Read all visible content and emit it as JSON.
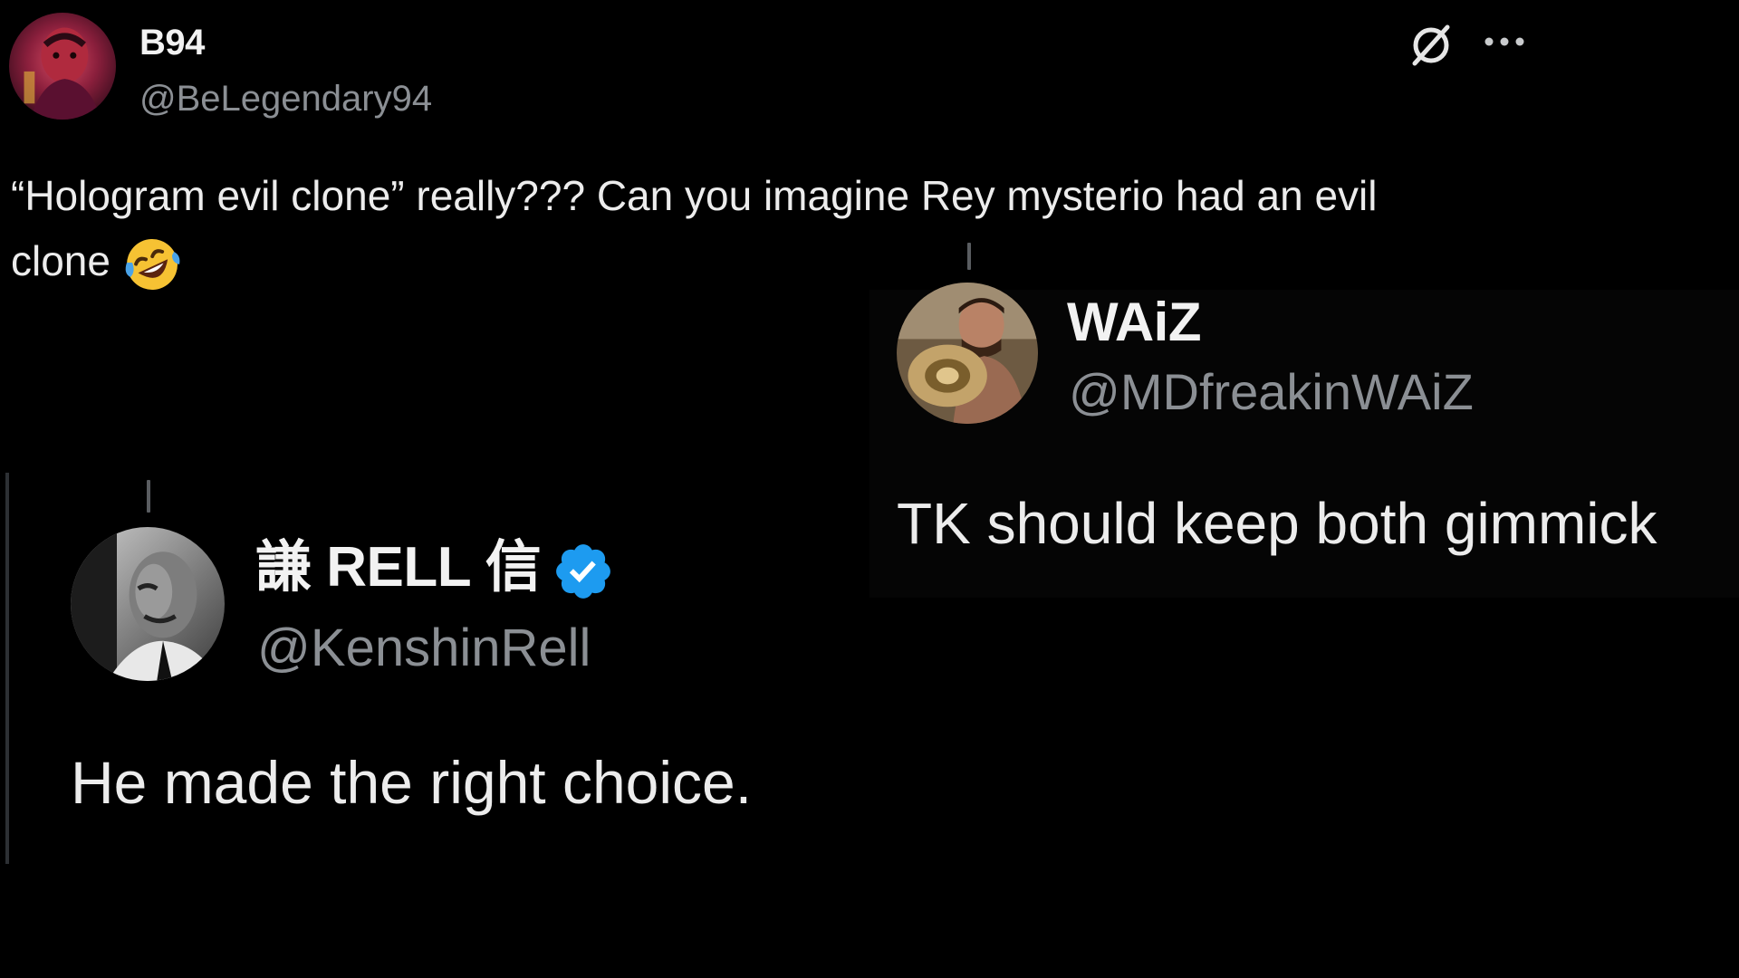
{
  "tweets": [
    {
      "display_name": "B94",
      "handle": "@BeLegendary94",
      "text_line1": "“Hologram evil clone” really??? Can you imagine Rey mysterio had an evil",
      "text_line2": "clone",
      "emoji": "rolling-on-floor-laughing",
      "icons": [
        "grok-icon",
        "more-options-icon"
      ]
    },
    {
      "display_name": "WAiZ",
      "handle": "@MDfreakinWAiZ",
      "text": "TK should keep both gimmick"
    },
    {
      "display_name": "謙 RELL 信",
      "handle": "@KenshinRell",
      "verified": true,
      "text": "He made the right choice."
    }
  ],
  "colors": {
    "background": "#000000",
    "primary_text": "#e7e9ea",
    "secondary_text": "#8b8f94",
    "verified_blue": "#1d9bf0"
  }
}
